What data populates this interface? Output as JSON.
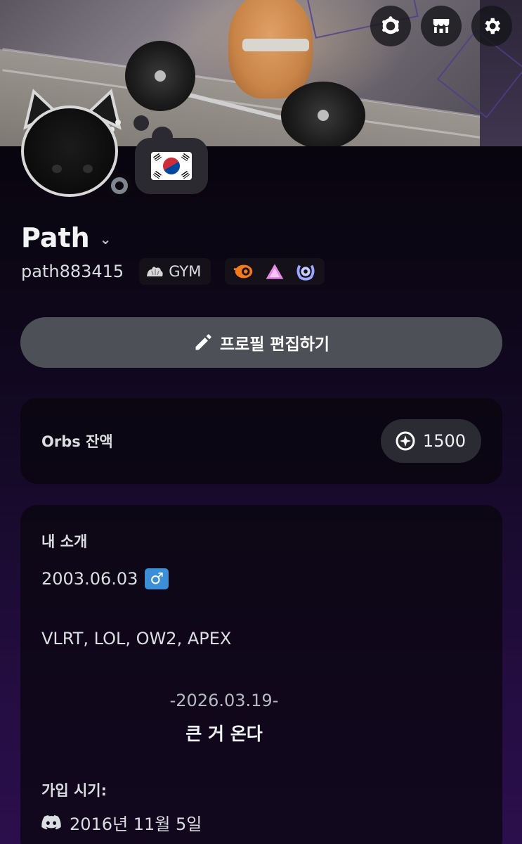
{
  "banner": {
    "description_icon": "banner-image"
  },
  "header_icons": [
    {
      "name": "nitro-badge-icon"
    },
    {
      "name": "shop-icon"
    },
    {
      "name": "settings-gear-icon"
    }
  ],
  "profile": {
    "display_name": "Path",
    "chevron": "⌄",
    "username": "path883415",
    "flag_icon": "south-korea-flag-icon",
    "guild_tag": {
      "label": "GYM"
    },
    "badges": [
      "hypesquad-icon",
      "triangle-badge-icon",
      "nitro-laurel-icon"
    ],
    "status_color": "#80848e"
  },
  "edit_button": {
    "label": "프로필 편집하기"
  },
  "orbs": {
    "label": "Orbs 잔액",
    "balance": "1500"
  },
  "about": {
    "title": "내 소개",
    "birthday": "2003.06.03",
    "gender_symbol": "♂",
    "games": "VLRT, LOL, OW2, APEX",
    "date_line": "-2026.03.19-",
    "announcement": "큰 거 온다"
  },
  "member_since": {
    "title": "가입 시기:",
    "date": "2016년 11월 5일"
  },
  "colors": {
    "accent": "#4e5058",
    "gender": "#3c8fd6",
    "background_bottom": "#2b0f4d"
  }
}
